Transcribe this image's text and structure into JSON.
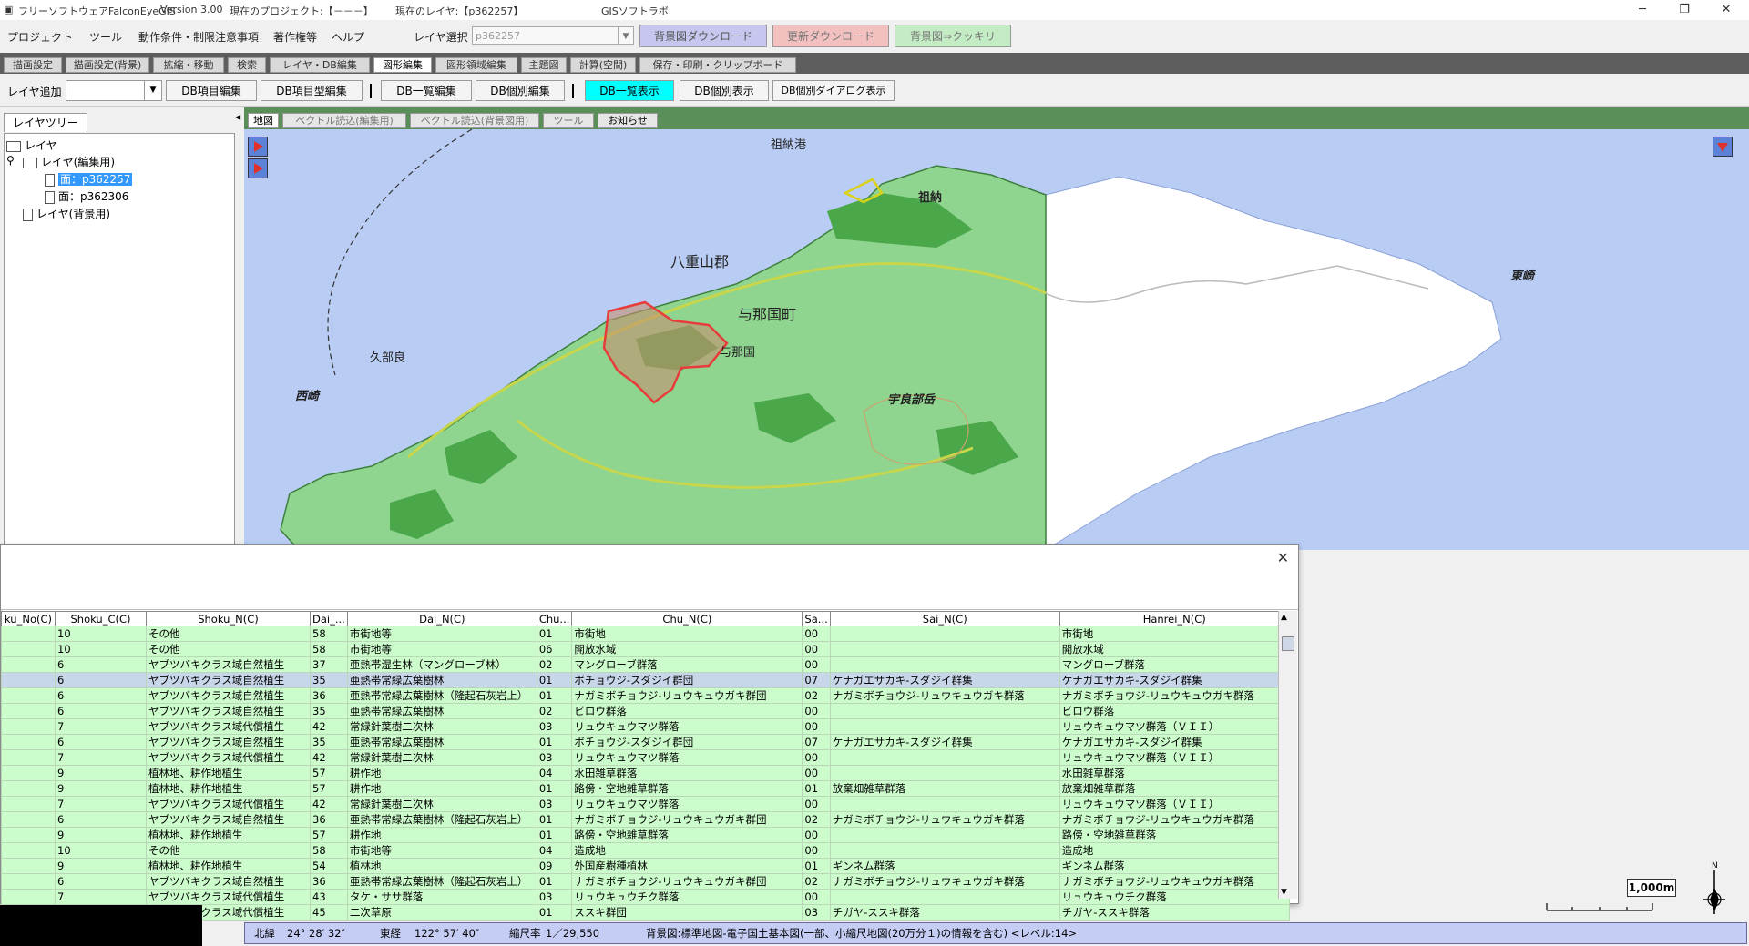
{
  "titlebar": {
    "app": "フリーソフトウェアFalconEyeGIS",
    "version": "Version 3.00",
    "project": "現在のプロジェクト:【－－－】",
    "layer": "現在のレイヤ:【p362257】",
    "org": "GISソフトラボ"
  },
  "menu": {
    "items": [
      "プロジェクト",
      "ツール",
      "動作条件・制限注意事項",
      "著作権等",
      "ヘルプ"
    ],
    "layer_select_label": "レイヤ選択",
    "layer_select_value": "p362257",
    "btn_bg_download": "背景図ダウンロード",
    "btn_update_download": "更新ダウンロード",
    "btn_bg_clear": "背景図⇒クッキリ"
  },
  "main_tabs": [
    "描画設定",
    "描画設定(背景)",
    "拡縮・移動",
    "検索",
    "レイヤ・DB編集",
    "図形編集",
    "図形領域編集",
    "主題図",
    "計算(空間)",
    "保存・印刷・クリップボード"
  ],
  "toolbar": {
    "add_layer": "レイヤ追加",
    "db_item_edit": "DB項目編集",
    "db_item_type_edit": "DB項目型編集",
    "db_list_edit": "DB一覧編集",
    "db_individual_edit": "DB個別編集",
    "db_list_view": "DB一覧表示",
    "db_individual_view": "DB個別表示",
    "db_individual_dialog": "DB個別ダイアログ表示"
  },
  "left": {
    "tab": "レイヤツリー",
    "root": "レイヤ",
    "edit_group": "レイヤ(編集用)",
    "layer1": "面：p362257",
    "layer2": "面：p362306",
    "bg_group": "レイヤ(背景用)"
  },
  "map_tabs": [
    "地図",
    "ベクトル読込(編集用)",
    "ベクトル読込(背景図用)",
    "ツール",
    "お知らせ"
  ],
  "map_labels": {
    "port": "祖納港",
    "sonai": "祖納",
    "higashizaki": "東崎",
    "county": "八重山郡",
    "town": "与那国町",
    "nishizaki": "西崎",
    "kubura": "久部良",
    "urabu": "宇良部岳",
    "yonaguni_label": "与那国"
  },
  "grid": {
    "columns": [
      "ku_No(C)",
      "Shoku_C(C)",
      "Shoku_N(C)",
      "Dai_...",
      "Dai_N(C)",
      "Chu...",
      "Chu_N(C)",
      "Sa...",
      "Sai_N(C)",
      "Hanrei_N(C)"
    ],
    "rows": [
      [
        "",
        "10",
        "その他",
        "58",
        "市街地等",
        "01",
        "市街地",
        "00",
        "",
        "市街地"
      ],
      [
        "",
        "10",
        "その他",
        "58",
        "市街地等",
        "06",
        "開放水域",
        "00",
        "",
        "開放水域"
      ],
      [
        "",
        "6",
        "ヤブツバキクラス域自然植生",
        "37",
        "亜熱帯湿生林（マングローブ林）",
        "02",
        "マングローブ群落",
        "00",
        "",
        "マングローブ群落"
      ],
      [
        "",
        "6",
        "ヤブツバキクラス域自然植生",
        "35",
        "亜熱帯常緑広葉樹林",
        "01",
        "ボチョウジ-スダジイ群団",
        "07",
        "ケナガエサカキ-スダジイ群集",
        "ケナガエサカキ-スダジイ群集"
      ],
      [
        "",
        "6",
        "ヤブツバキクラス域自然植生",
        "36",
        "亜熱帯常緑広葉樹林（隆起石灰岩上）",
        "01",
        "ナガミボチョウジ-リュウキュウガキ群団",
        "02",
        "ナガミボチョウジ-リュウキュウガキ群落",
        "ナガミボチョウジ-リュウキュウガキ群落"
      ],
      [
        "",
        "6",
        "ヤブツバキクラス域自然植生",
        "35",
        "亜熱帯常緑広葉樹林",
        "02",
        "ビロウ群落",
        "00",
        "",
        "ビロウ群落"
      ],
      [
        "",
        "7",
        "ヤブツバキクラス域代償植生",
        "42",
        "常緑針葉樹二次林",
        "03",
        "リュウキュウマツ群落",
        "00",
        "",
        "リュウキュウマツ群落（ＶＩＩ）"
      ],
      [
        "",
        "6",
        "ヤブツバキクラス域自然植生",
        "35",
        "亜熱帯常緑広葉樹林",
        "01",
        "ボチョウジ-スダジイ群団",
        "07",
        "ケナガエサカキ-スダジイ群集",
        "ケナガエサカキ-スダジイ群集"
      ],
      [
        "",
        "7",
        "ヤブツバキクラス域代償植生",
        "42",
        "常緑針葉樹二次林",
        "03",
        "リュウキュウマツ群落",
        "00",
        "",
        "リュウキュウマツ群落（ＶＩＩ）"
      ],
      [
        "",
        "9",
        "植林地、耕作地植生",
        "57",
        "耕作地",
        "04",
        "水田雑草群落",
        "00",
        "",
        "水田雑草群落"
      ],
      [
        "",
        "9",
        "植林地、耕作地植生",
        "57",
        "耕作地",
        "01",
        "路傍・空地雑草群落",
        "01",
        "放棄畑雑草群落",
        "放棄畑雑草群落"
      ],
      [
        "",
        "7",
        "ヤブツバキクラス域代償植生",
        "42",
        "常緑針葉樹二次林",
        "03",
        "リュウキュウマツ群落",
        "00",
        "",
        "リュウキュウマツ群落（ＶＩＩ）"
      ],
      [
        "",
        "6",
        "ヤブツバキクラス域自然植生",
        "36",
        "亜熱帯常緑広葉樹林（隆起石灰岩上）",
        "01",
        "ナガミボチョウジ-リュウキュウガキ群団",
        "02",
        "ナガミボチョウジ-リュウキュウガキ群落",
        "ナガミボチョウジ-リュウキュウガキ群落"
      ],
      [
        "",
        "9",
        "植林地、耕作地植生",
        "57",
        "耕作地",
        "01",
        "路傍・空地雑草群落",
        "00",
        "",
        "路傍・空地雑草群落"
      ],
      [
        "",
        "10",
        "その他",
        "58",
        "市街地等",
        "04",
        "造成地",
        "00",
        "",
        "造成地"
      ],
      [
        "",
        "9",
        "植林地、耕作地植生",
        "54",
        "植林地",
        "09",
        "外国産樹種植林",
        "01",
        "ギンネム群落",
        "ギンネム群落"
      ],
      [
        "",
        "6",
        "ヤブツバキクラス域自然植生",
        "36",
        "亜熱帯常緑広葉樹林（隆起石灰岩上）",
        "01",
        "ナガミボチョウジ-リュウキュウガキ群団",
        "02",
        "ナガミボチョウジ-リュウキュウガキ群落",
        "ナガミボチョウジ-リュウキュウガキ群落"
      ],
      [
        "",
        "7",
        "ヤブツバキクラス域代償植生",
        "43",
        "タケ・ササ群落",
        "03",
        "リュウキュウチク群落",
        "00",
        "",
        "リュウキュウチク群落"
      ],
      [
        "",
        "7",
        "ヤブツバキクラス域代償植生",
        "45",
        "二次草原",
        "01",
        "ススキ群団",
        "03",
        "チガヤ-ススキ群落",
        "チガヤ-ススキ群落"
      ]
    ]
  },
  "scale": "1,000m",
  "status": {
    "lat_label": "北緯",
    "lat": "24° 28′ 32″",
    "lon_label": "東経",
    "lon": "122° 57′ 40″",
    "scale_label": "縮尺率",
    "scale": "1／29,550",
    "bg": "背景図:標準地図-電子国土基本図(一部、小縮尺地図(20万分１)の情報を含む) <レベル:14>"
  },
  "colors": {
    "accent_cyan": "#00ffff",
    "land_green": "#8fd48f",
    "forest_green": "#4aa74a",
    "sea": "#b9cdf4",
    "red_polygon": "#e83b3b"
  }
}
